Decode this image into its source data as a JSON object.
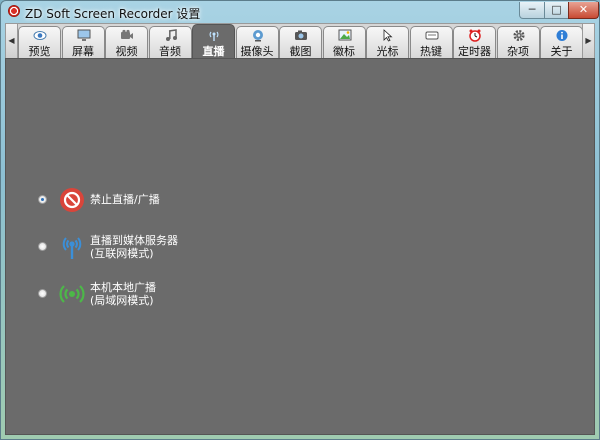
{
  "window": {
    "title": "ZD Soft Screen Recorder 设置",
    "min_label": "─",
    "max_label": "□",
    "close_label": "✕"
  },
  "tabs": [
    {
      "label": "预览",
      "icon": "preview-icon",
      "active": false
    },
    {
      "label": "屏幕",
      "icon": "screen-icon",
      "active": false
    },
    {
      "label": "视频",
      "icon": "video-icon",
      "active": false
    },
    {
      "label": "音频",
      "icon": "audio-icon",
      "active": false
    },
    {
      "label": "直播",
      "icon": "live-icon",
      "active": true
    },
    {
      "label": "摄像头",
      "icon": "webcam-icon",
      "active": false
    },
    {
      "label": "截图",
      "icon": "camera-icon",
      "active": false
    },
    {
      "label": "徽标",
      "icon": "logo-image-icon",
      "active": false
    },
    {
      "label": "光标",
      "icon": "cursor-icon",
      "active": false
    },
    {
      "label": "热键",
      "icon": "hotkey-icon",
      "active": false
    },
    {
      "label": "定时器",
      "icon": "timer-icon",
      "active": false
    },
    {
      "label": "杂项",
      "icon": "misc-gear-icon",
      "active": false
    },
    {
      "label": "关于",
      "icon": "info-icon",
      "active": false
    }
  ],
  "scroll": {
    "left": "◀",
    "right": "▶"
  },
  "live_options": [
    {
      "line1": "禁止直播/广播",
      "line2": "",
      "icon": "no-broadcast-icon",
      "checked": true
    },
    {
      "line1": "直播到媒体服务器",
      "line2": "(互联网模式)",
      "icon": "media-server-icon",
      "checked": false
    },
    {
      "line1": "本机本地广播",
      "line2": "(局域网模式)",
      "icon": "local-broadcast-icon",
      "checked": false
    }
  ],
  "colors": {
    "active_tab": "#6b6b6b",
    "panel_bg": "#6b6b6b",
    "disable_red": "#d9453a",
    "server_blue": "#3b8fd8",
    "local_green": "#4cb848"
  }
}
